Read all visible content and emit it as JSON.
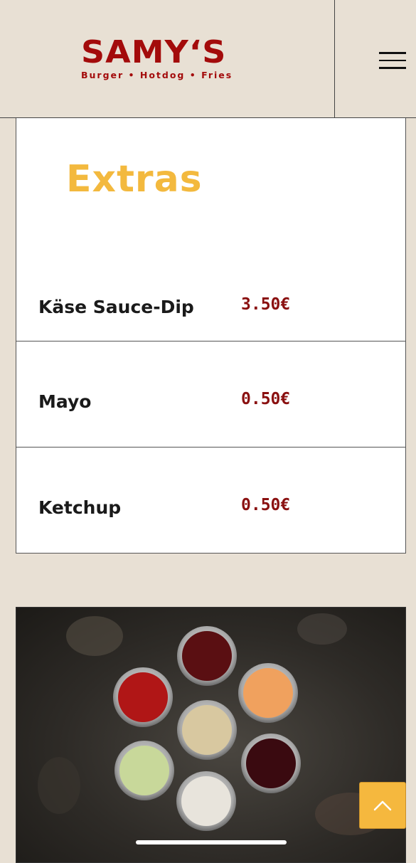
{
  "header": {
    "logo_title": "SAMY‘S",
    "logo_subtitle": "Burger • Hotdog • Fries",
    "menu_icon": "hamburger-menu-icon"
  },
  "menu": {
    "title": "Extras",
    "items": [
      {
        "name": "Käse Sauce-Dip",
        "price": "3.50€"
      },
      {
        "name": "Mayo",
        "price": "0.50€"
      },
      {
        "name": "Ketchup",
        "price": "0.50€"
      }
    ]
  },
  "photo": {
    "sauce_colors": [
      "#5a0f12",
      "#b01616",
      "#f0a15e",
      "#d8c8a0",
      "#c8d89a",
      "#3a0a10",
      "#e8e4dc"
    ]
  },
  "scroll_top": {
    "icon": "chevron-up-icon"
  },
  "colors": {
    "brand": "#a30b0b",
    "title": "#f3b93e",
    "price": "#8a1010",
    "accent": "#f5b83e",
    "background": "#e8e0d4"
  }
}
